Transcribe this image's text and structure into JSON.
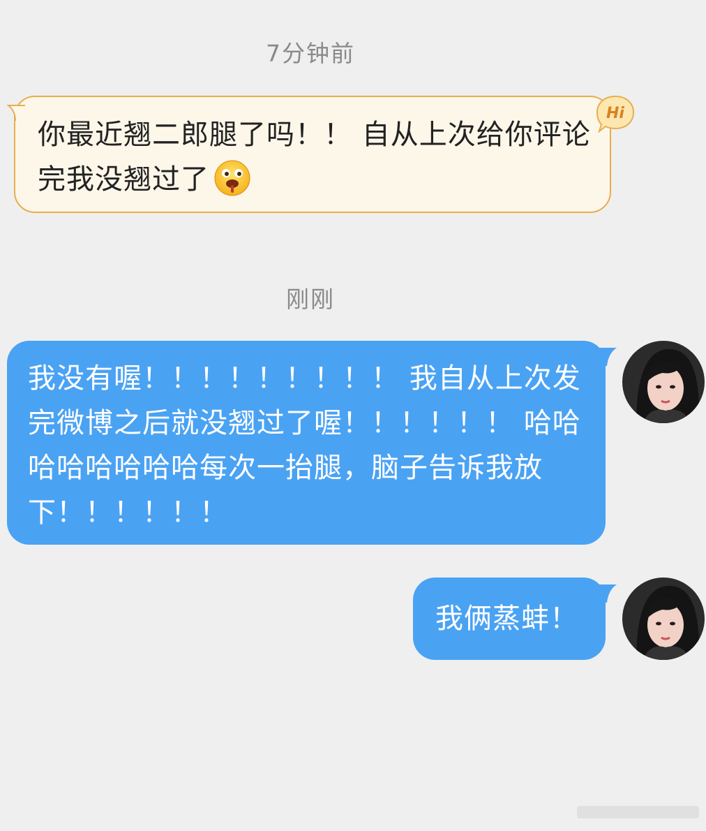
{
  "conversation": {
    "timestamp_1": "7分钟前",
    "incoming_message": {
      "text": "你最近翘二郎腿了吗！！ 自从上次给你评论完我没翘过了",
      "badge": "Hi",
      "emoji": "drooling-face-emoji"
    },
    "timestamp_2": "刚刚",
    "outgoing_messages": [
      {
        "text": "我没有喔！！！！！！！！！ 我自从上次发完微博之后就没翘过了喔！！！！！！ 哈哈哈哈哈哈哈哈每次一抬腿，脑子告诉我放下！！！！！！"
      },
      {
        "text": "我俩蒸蚌！"
      }
    ]
  },
  "colors": {
    "background": "#efefef",
    "incoming_bubble": "#fdf7ea",
    "incoming_border": "#e8ad4e",
    "outgoing_bubble": "#4aa2f3",
    "timestamp": "#8a8a8a"
  }
}
